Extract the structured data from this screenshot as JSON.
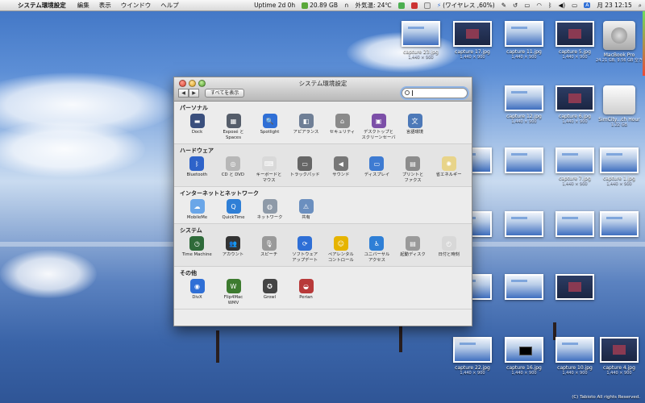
{
  "menubar": {
    "apple": "",
    "app_name": "システム環境設定",
    "menus": [
      "編集",
      "表示",
      "ウインドウ",
      "ヘルプ"
    ],
    "status": {
      "uptime": "Uptime 2d 0h",
      "disk": "20.89 GB",
      "temp": "外気温: 24℃",
      "battery": "(ワイヤレス ,60%)",
      "date": "月 23 12:15"
    }
  },
  "desktop": {
    "icons": [
      {
        "name": "capture 23.jpg",
        "sub": "1,440 × 900",
        "style": "light"
      },
      {
        "name": "capture 17.jpg",
        "sub": "1,440 × 900",
        "style": "dark"
      },
      {
        "name": "capture 11.jpg",
        "sub": "1,440 × 900",
        "style": "light"
      },
      {
        "name": "capture 5.jpg",
        "sub": "1,440 × 900",
        "style": "dark"
      },
      {
        "name": "MacBook Pro",
        "sub": "24.21 GB, 9.56 GB 空き",
        "style": "hd"
      },
      {
        "name": "",
        "sub": "",
        "style": "light"
      },
      {
        "name": "capture 12.jpg",
        "sub": "1,440 × 900",
        "style": "light"
      },
      {
        "name": "capture 6.jpg",
        "sub": "1,440 × 900",
        "style": "dark"
      },
      {
        "name": "SimCity...ch Hour",
        "sub": "1.22 GB",
        "style": "wd"
      },
      {
        "name": "",
        "sub": "",
        "style": "light"
      },
      {
        "name": "",
        "sub": "",
        "style": "light"
      },
      {
        "name": "",
        "sub": "",
        "style": "light"
      },
      {
        "name": "capture 7.jpg",
        "sub": "1,440 × 900",
        "style": "light"
      },
      {
        "name": "capture 1.jpg",
        "sub": "1,440 × 900",
        "style": "light"
      },
      {
        "name": "",
        "sub": "",
        "style": "light"
      },
      {
        "name": "",
        "sub": "",
        "style": "light"
      },
      {
        "name": "",
        "sub": "",
        "style": "light"
      },
      {
        "name": "",
        "sub": "",
        "style": "light"
      },
      {
        "name": "",
        "sub": "",
        "style": "light"
      },
      {
        "name": "",
        "sub": "",
        "style": "dark"
      },
      {
        "name": "",
        "sub": "",
        "style": "light"
      },
      {
        "name": "",
        "sub": "",
        "style": "light"
      },
      {
        "name": "",
        "sub": "",
        "style": "dark"
      },
      {
        "name": "capture 22.jpg",
        "sub": "1,440 × 900",
        "style": "light"
      },
      {
        "name": "capture 16.jpg",
        "sub": "1,440 × 900",
        "style": "black"
      },
      {
        "name": "capture 10.jpg",
        "sub": "1,440 × 900",
        "style": "light"
      },
      {
        "name": "capture 4.jpg",
        "sub": "1,440 × 900",
        "style": "dark"
      }
    ],
    "copyright": "(C) Tabioto All rights Reserved."
  },
  "window": {
    "title": "システム環境設定",
    "back": "◀",
    "forward": "▶",
    "show_all": "すべてを表示",
    "search_placeholder": "",
    "sections": [
      {
        "title": "パーソナル",
        "items": [
          {
            "label": "Dock",
            "icon": "dock-icon",
            "color": "#3a4f7d",
            "glyph": "▬"
          },
          {
            "label": "Exposé と\nSpaces",
            "icon": "expose-icon",
            "color": "#555d6a",
            "glyph": "▦"
          },
          {
            "label": "Spotlight",
            "icon": "spotlight-icon",
            "color": "#2f6fd6",
            "glyph": "🔍"
          },
          {
            "label": "アピアランス",
            "icon": "appearance-icon",
            "color": "#6f7f96",
            "glyph": "◧"
          },
          {
            "label": "セキュリティ",
            "icon": "security-icon",
            "color": "#8a8a8a",
            "glyph": "⌂"
          },
          {
            "label": "デスクトップと\nスクリーンセーバ",
            "icon": "desktop-icon",
            "color": "#7c4fa8",
            "glyph": "▣"
          },
          {
            "label": "言語環境",
            "icon": "language-icon",
            "color": "#4d79b8",
            "glyph": "文"
          }
        ]
      },
      {
        "title": "ハードウェア",
        "items": [
          {
            "label": "Bluetooth",
            "icon": "bluetooth-icon",
            "color": "#2e63c9",
            "glyph": "ᛒ"
          },
          {
            "label": "CD と DVD",
            "icon": "cd-icon",
            "color": "#b7b7b7",
            "glyph": "◎"
          },
          {
            "label": "キーボードと\nマウス",
            "icon": "keyboard-icon",
            "color": "#d9d9d9",
            "glyph": "⌨"
          },
          {
            "label": "トラックパッド",
            "icon": "trackpad-icon",
            "color": "#666666",
            "glyph": "▭"
          },
          {
            "label": "サウンド",
            "icon": "sound-icon",
            "color": "#777777",
            "glyph": "◀"
          },
          {
            "label": "ディスプレイ",
            "icon": "display-icon",
            "color": "#3e7bd2",
            "glyph": "▭"
          },
          {
            "label": "プリントと\nファクス",
            "icon": "print-icon",
            "color": "#8c8c8c",
            "glyph": "▤"
          },
          {
            "label": "省エネルギー",
            "icon": "energy-icon",
            "color": "#e8d48a",
            "glyph": "✺"
          }
        ]
      },
      {
        "title": "インターネットとネットワーク",
        "items": [
          {
            "label": "MobileMe",
            "icon": "mobileme-icon",
            "color": "#6aa6e8",
            "glyph": "☁"
          },
          {
            "label": "QuickTime",
            "icon": "quicktime-icon",
            "color": "#2f7fd6",
            "glyph": "Q"
          },
          {
            "label": "ネットワーク",
            "icon": "network-icon",
            "color": "#8e9aa8",
            "glyph": "◍"
          },
          {
            "label": "共有",
            "icon": "sharing-icon",
            "color": "#6b8fbf",
            "glyph": "⚠"
          }
        ]
      },
      {
        "title": "システム",
        "items": [
          {
            "label": "Time Machine",
            "icon": "timemachine-icon",
            "color": "#2f6b3a",
            "glyph": "◷"
          },
          {
            "label": "アカウント",
            "icon": "accounts-icon",
            "color": "#333333",
            "glyph": "👥"
          },
          {
            "label": "スピーチ",
            "icon": "speech-icon",
            "color": "#999999",
            "glyph": "🎙"
          },
          {
            "label": "ソフトウェア\nアップデート",
            "icon": "softwareupdate-icon",
            "color": "#2f6fd6",
            "glyph": "⟳"
          },
          {
            "label": "ペアレンタル\nコントロール",
            "icon": "parental-icon",
            "color": "#e6b400",
            "glyph": "☺"
          },
          {
            "label": "ユニバーサル\nアクセス",
            "icon": "universal-access-icon",
            "color": "#2f7fd6",
            "glyph": "♿"
          },
          {
            "label": "起動ディスク",
            "icon": "startupdisk-icon",
            "color": "#9a9a9a",
            "glyph": "▤"
          },
          {
            "label": "日付と時刻",
            "icon": "datetime-icon",
            "color": "#d8d8d8",
            "glyph": "◴"
          }
        ]
      },
      {
        "title": "その他",
        "items": [
          {
            "label": "DivX",
            "icon": "divx-icon",
            "color": "#2f6fd6",
            "glyph": "◉"
          },
          {
            "label": "Flip4Mac\nWMV",
            "icon": "flip4mac-icon",
            "color": "#3d7b2f",
            "glyph": "W"
          },
          {
            "label": "Growl",
            "icon": "growl-icon",
            "color": "#444444",
            "glyph": "✪"
          },
          {
            "label": "Perian",
            "icon": "perian-icon",
            "color": "#b83a3a",
            "glyph": "◒"
          }
        ]
      }
    ]
  }
}
